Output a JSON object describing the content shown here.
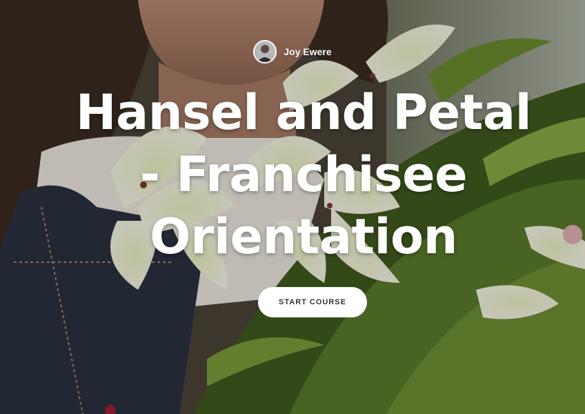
{
  "author": {
    "name": "Joy Ewere"
  },
  "course": {
    "title": "Hansel and Petal - Franchisee Orientation"
  },
  "actions": {
    "start_label": "START COURSE"
  },
  "colors": {
    "button_bg": "#ffffff",
    "button_text": "#333333",
    "title_text": "#ffffff",
    "apron": "#2a3040",
    "leaves": "#5a7a2a",
    "lily": "#f1f0dc",
    "hair": "#3a2a22"
  }
}
